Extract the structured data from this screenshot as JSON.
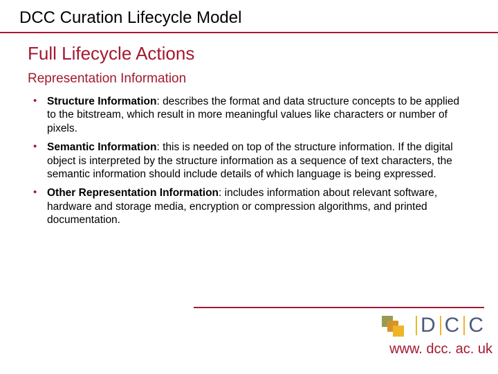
{
  "header": {
    "title": "DCC Curation Lifecycle Model"
  },
  "main": {
    "heading": "Full Lifecycle Actions",
    "subheading": "Representation Information",
    "bullets": [
      {
        "term": "Structure Information",
        "desc": ": describes the format and data structure concepts to be applied to the bitstream, which result in more meaningful values like characters or number of pixels."
      },
      {
        "term": "Semantic Information",
        "desc": ": this is needed on top of the structure information. If the digital object is interpreted by the structure information as a sequence of text characters, the semantic information should include details of which language is being expressed."
      },
      {
        "term": "Other Representation Information",
        "desc": ": includes information about relevant software, hardware and storage media, encryption or compression algorithms, and printed documentation."
      }
    ]
  },
  "footer": {
    "logo_letters": [
      "D",
      "C",
      "C"
    ],
    "url": "www. dcc. ac. uk"
  }
}
